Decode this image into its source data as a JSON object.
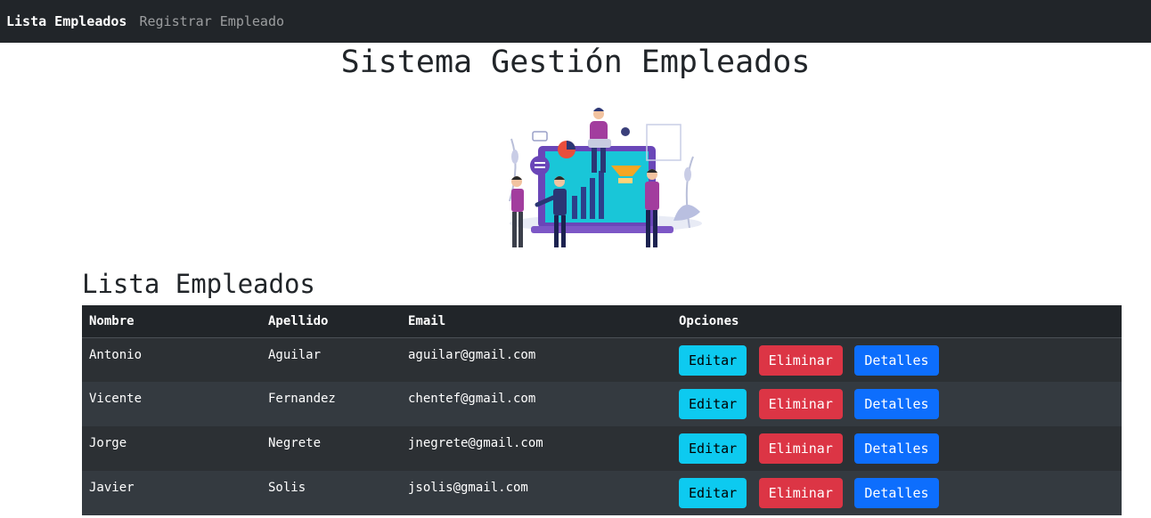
{
  "nav": {
    "links": [
      {
        "label": "Lista Empleados"
      },
      {
        "label": "Registrar Empleado"
      }
    ]
  },
  "page_title": "Sistema Gestión Empleados",
  "section_title": "Lista Empleados",
  "table": {
    "headers": [
      "Nombre",
      "Apellido",
      "Email",
      "Opciones"
    ],
    "rows": [
      {
        "nombre": "Antonio",
        "apellido": "Aguilar",
        "email": "aguilar@gmail.com"
      },
      {
        "nombre": "Vicente",
        "apellido": "Fernandez",
        "email": "chentef@gmail.com"
      },
      {
        "nombre": "Jorge",
        "apellido": "Negrete",
        "email": "jnegrete@gmail.com"
      },
      {
        "nombre": "Javier",
        "apellido": "Solis",
        "email": "jsolis@gmail.com"
      }
    ],
    "actions": {
      "edit": "Editar",
      "delete": "Eliminar",
      "details": "Detalles"
    }
  },
  "colors": {
    "navbar": "#212529",
    "edit": "#0dcaf0",
    "delete": "#dc3545",
    "details": "#0d6efd"
  },
  "illustration": "team-dashboard-illustration"
}
